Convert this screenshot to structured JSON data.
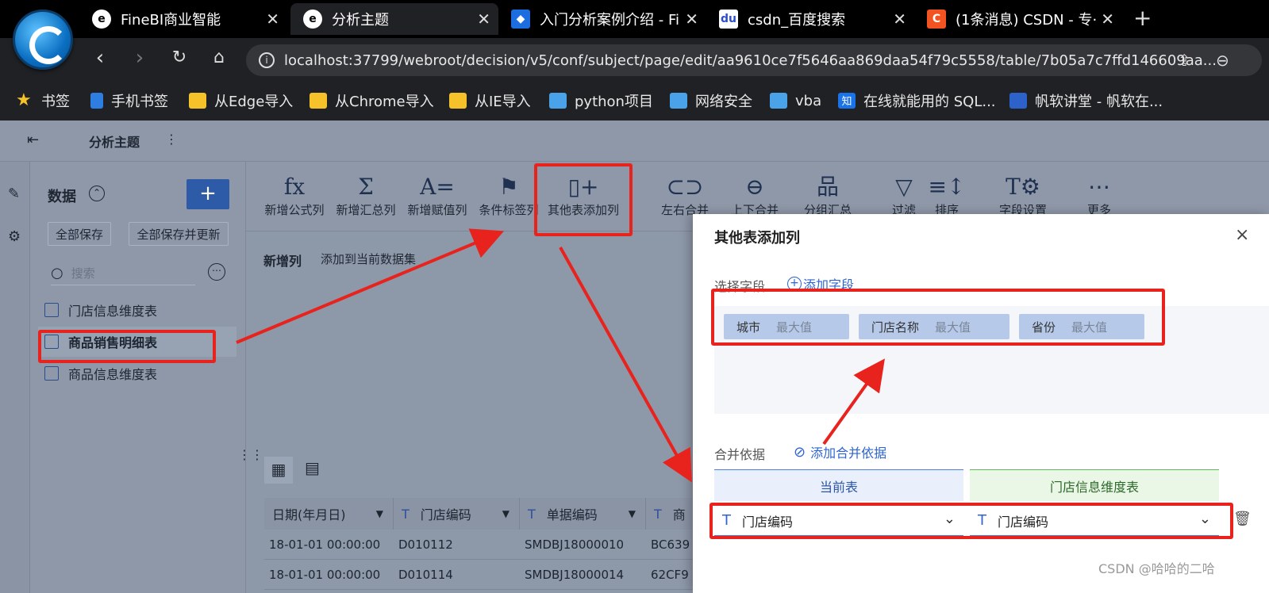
{
  "browser": {
    "tabs": [
      {
        "title": "FineBI商业智能",
        "active": false
      },
      {
        "title": "分析主题",
        "active": true
      },
      {
        "title": "入门分析案例介绍 - Fi",
        "active": false
      },
      {
        "title": "csdn_百度搜索",
        "active": false
      },
      {
        "title": "(1条消息) CSDN - 专·",
        "active": false
      }
    ],
    "new_tab": "+",
    "url": "localhost:37799/webroot/decision/v5/conf/subject/page/edit/aa9610ce7f5646aa869daa54f79c5558/table/7b05a7c7ffd146609aa...",
    "bookmarks": [
      "书签",
      "手机书签",
      "从Edge导入",
      "从Chrome导入",
      "从IE导入",
      "python项目",
      "网络安全",
      "vba",
      "在线就能用的 SQL...",
      "帆软讲堂 - 帆软在..."
    ]
  },
  "app": {
    "title": "分析主题",
    "data_panel": {
      "heading": "数据",
      "add_label": "+",
      "save_all": "全部保存",
      "save_all_update": "全部保存并更新",
      "search_placeholder": "搜索",
      "tables": [
        "门店信息维度表",
        "商品销售明细表",
        "商品信息维度表"
      ],
      "selected_table": "商品销售明细表"
    },
    "toolbar": [
      {
        "icon": "fx-icon",
        "glyph": "fx",
        "label": "新增公式列"
      },
      {
        "icon": "sigma-icon",
        "glyph": "Σ",
        "label": "新增汇总列"
      },
      {
        "icon": "assign-icon",
        "glyph": "A=",
        "label": "新增赋值列"
      },
      {
        "icon": "flag-icon",
        "glyph": "⚑",
        "label": "条件标签列"
      },
      {
        "icon": "add-column-icon",
        "glyph": "▯+",
        "label": "其他表添加列"
      },
      {
        "icon": "merge-lr-icon",
        "glyph": "⊂⊃",
        "label": "左右合并"
      },
      {
        "icon": "merge-ud-icon",
        "glyph": "⊖",
        "label": "上下合并"
      },
      {
        "icon": "group-icon",
        "glyph": "品",
        "label": "分组汇总"
      },
      {
        "icon": "filter-icon",
        "glyph": "▽",
        "label": "过滤"
      },
      {
        "icon": "sort-icon",
        "glyph": "≡↕",
        "label": "排序"
      },
      {
        "icon": "field-setting-icon",
        "glyph": "T⚙",
        "label": "字段设置"
      },
      {
        "icon": "more-icon",
        "glyph": "⋯",
        "label": "更多"
      }
    ],
    "new_column": {
      "label": "新增列",
      "action": "添加到当前数据集"
    },
    "table_grid": {
      "headers": [
        "日期(年月日)",
        "门店编码",
        "单据编码",
        "商"
      ],
      "rows": [
        [
          "18-01-01 00:00:00",
          "D010112",
          "SMDBJ18000010",
          "BC639"
        ],
        [
          "18-01-01 00:00:00",
          "D010114",
          "SMDBJ18000014",
          "62CF9"
        ]
      ]
    }
  },
  "dialog": {
    "title": "其他表添加列",
    "close": "×",
    "select_field_label": "选择字段",
    "add_field": "添加字段",
    "fields": [
      {
        "name": "城市",
        "agg": "最大值"
      },
      {
        "name": "门店名称",
        "agg": "最大值"
      },
      {
        "name": "省份",
        "agg": "最大值"
      }
    ],
    "merge_label": "合并依据",
    "add_merge": "添加合并依据",
    "current_table": "当前表",
    "other_table": "门店信息维度表",
    "current_field": "门店编码",
    "other_field": "门店编码"
  },
  "watermark": "CSDN @哈哈的二哈",
  "colors": {
    "annotation": "#e8231e",
    "primary": "#2d5ba8",
    "link": "#2e64cf"
  }
}
